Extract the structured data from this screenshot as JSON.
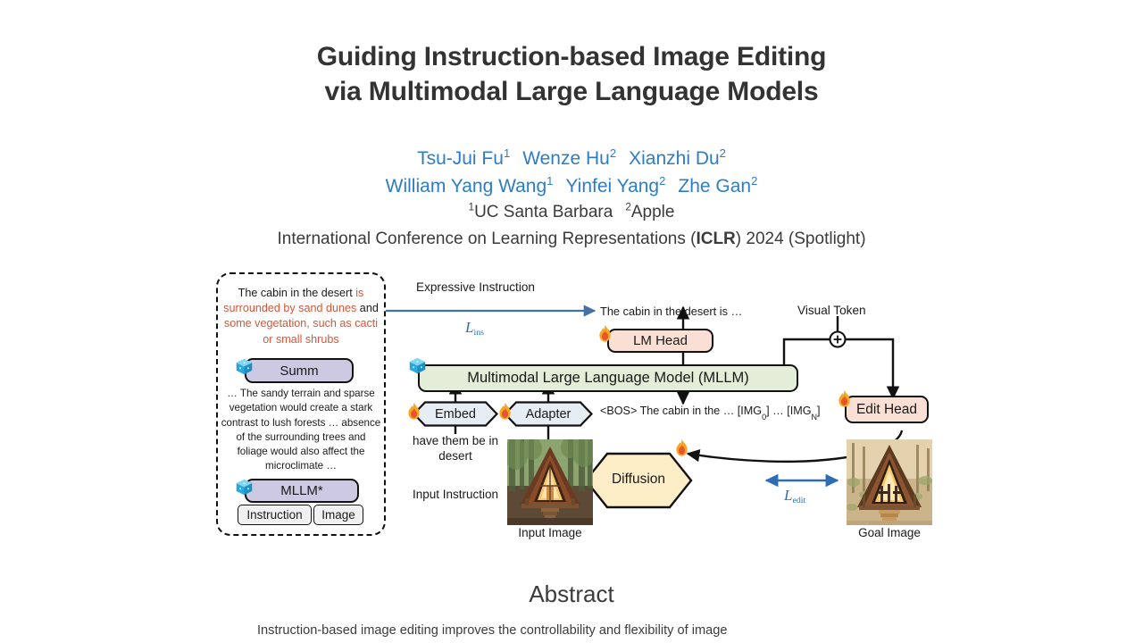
{
  "paper": {
    "title_line1": "Guiding Instruction-based Image Editing",
    "title_line2": "via Multimodal Large Language Models",
    "authors_row1": [
      {
        "name": "Tsu-Jui Fu",
        "affil": "1"
      },
      {
        "name": "Wenze Hu",
        "affil": "2"
      },
      {
        "name": "Xianzhi Du",
        "affil": "2"
      }
    ],
    "authors_row2": [
      {
        "name": "William Yang Wang",
        "affil": "1"
      },
      {
        "name": "Yinfei Yang",
        "affil": "2"
      },
      {
        "name": "Zhe Gan",
        "affil": "2"
      }
    ],
    "affiliations": [
      {
        "marker": "1",
        "name": "UC Santa Barbara"
      },
      {
        "marker": "2",
        "name": "Apple"
      }
    ],
    "venue_prefix": "International Conference on Learning Representations (",
    "venue_bold": "ICLR",
    "venue_suffix": ") 2024 (Spotlight)"
  },
  "figure": {
    "expressive_instruction_label": "Expressive Instruction",
    "visual_token_label": "Visual Token",
    "plus_symbol": "+",
    "expressive_text": {
      "seg1": "The cabin in the desert ",
      "seg2_hl": "is surrounded by sand dunes",
      "seg3": " and ",
      "seg4_hl": "some vegetation, such as cacti or small shrubs"
    },
    "summary_text": "… The sandy terrain and sparse vegetation would create a stark contrast to lush forests … absence of the surrounding trees and foliage would also affect the microclimate …",
    "output_instruction": "The cabin in the desert is …",
    "token_sequence": {
      "bos": "<BOS>",
      "text": " The cabin in the …  [IMG",
      "sub0": "0",
      "mid": "] … [IMG",
      "subN": "N",
      "end": "]"
    },
    "blocks": {
      "summ": "Summ",
      "mllm_star": "MLLM*",
      "instruction": "Instruction",
      "image": "Image",
      "lm_head": "LM Head",
      "mllm": "Multimodal Large Language Model (MLLM)",
      "embed": "Embed",
      "adapter": "Adapter",
      "edit_head": "Edit Head",
      "diffusion": "Diffusion"
    },
    "losses": {
      "ins_symbol": "L",
      "ins_sub": "ins",
      "edit_symbol": "L",
      "edit_sub": "edit"
    },
    "captions": {
      "input_instruction_text": "have them be in desert",
      "input_instruction": "Input Instruction",
      "input_image": "Input Image",
      "goal_image": "Goal Image"
    },
    "icons": {
      "frozen": "frozen-snowflake-cube-icon",
      "trainable": "fire-flame-icon"
    },
    "colors": {
      "purple_block": "#cdc9e2",
      "green_block": "#e4edd8",
      "peach_block": "#fae0d4",
      "blue_block": "#e7edf5",
      "cream_block": "#fdeec8",
      "highlight_text": "#d4573a",
      "loss_blue": "#2e6db4",
      "arrow_blue": "#4472a8",
      "author_blue": "#2e7cc4"
    }
  },
  "abstract": {
    "heading": "Abstract",
    "paragraph": "Instruction-based image editing improves the controllability and flexibility of image"
  }
}
